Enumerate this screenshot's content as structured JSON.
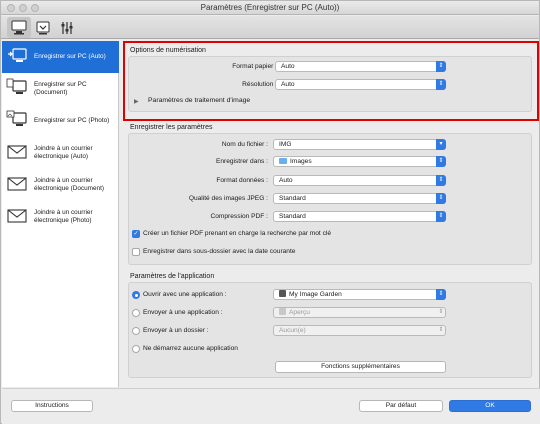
{
  "window": {
    "title": "Paramètres (Enregistrer sur PC (Auto))"
  },
  "toolbar": {
    "tabs": [
      "scan-to-pc-icon",
      "scan-from-panel-icon",
      "general-settings-icon"
    ]
  },
  "sidebar": {
    "items": [
      {
        "label": "Enregistrer sur PC (Auto)",
        "icon": "save-to-pc-icon",
        "selected": true
      },
      {
        "label": "Enregistrer sur PC (Document)",
        "icon": "save-document-icon",
        "selected": false
      },
      {
        "label": "Enregistrer sur PC (Photo)",
        "icon": "save-photo-icon",
        "selected": false
      },
      {
        "label": "Joindre à un courrier électronique (Auto)",
        "icon": "email-auto-icon",
        "selected": false
      },
      {
        "label": "Joindre à un courrier électronique (Document)",
        "icon": "email-document-icon",
        "selected": false
      },
      {
        "label": "Joindre à un courrier électronique (Photo)",
        "icon": "email-photo-icon",
        "selected": false
      }
    ]
  },
  "scan_options": {
    "title": "Options de numérisation",
    "paper_size_label": "Format papier :",
    "paper_size_value": "Auto",
    "resolution_label": "Résolution :",
    "resolution_value": "Auto",
    "image_processing_label": "Paramètres de traitement d'image"
  },
  "save_settings": {
    "title": "Enregistrer les paramètres",
    "file_name_label": "Nom du fichier :",
    "file_name_value": "IMG",
    "save_in_label": "Enregistrer dans :",
    "save_in_value": "Images",
    "data_format_label": "Format données :",
    "data_format_value": "Auto",
    "jpeg_quality_label": "Qualité des images JPEG :",
    "jpeg_quality_value": "Standard",
    "pdf_compression_label": "Compression PDF :",
    "pdf_compression_value": "Standard",
    "searchable_pdf_label": "Créer un fichier PDF prenant en charge la recherche par mot clé",
    "subfolder_label": "Enregistrer dans sous-dossier avec la date courante"
  },
  "app_settings": {
    "title": "Paramètres de l'application",
    "open_with_label": "Ouvrir avec une application :",
    "open_with_value": "My Image Garden",
    "send_to_app_label": "Envoyer à une application :",
    "send_to_app_value": "Aperçu",
    "send_to_folder_label": "Envoyer à un dossier :",
    "send_to_folder_value": "Aucun(e)",
    "no_app_label": "Ne démarrez aucune application",
    "more_functions_label": "Fonctions supplémentaires"
  },
  "footer": {
    "instructions_label": "Instructions",
    "defaults_label": "Par défaut",
    "ok_label": "OK"
  },
  "colors": {
    "accent": "#2f7ae5",
    "selection": "#1f6fd6",
    "highlight": "#e00000"
  }
}
